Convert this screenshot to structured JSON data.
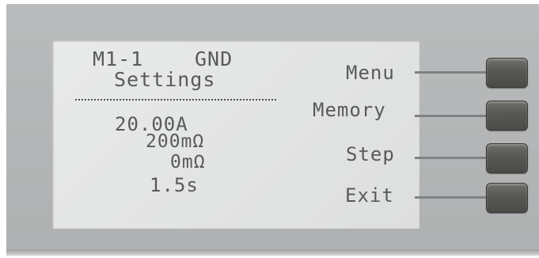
{
  "screen": {
    "header": {
      "mode": "M1-1",
      "test_type": "GND",
      "title": "Settings"
    },
    "values": [
      "20.00A",
      "200mΩ",
      "0mΩ",
      "1.5s"
    ]
  },
  "softkeys": [
    {
      "label": "Menu"
    },
    {
      "label": "Memory"
    },
    {
      "label": "Step"
    },
    {
      "label": "Exit"
    }
  ],
  "colors": {
    "lcd_background": "#e3e4e4",
    "lcd_text": "#585a5b",
    "bezel": "#b5b7b8",
    "button": "#555652"
  }
}
